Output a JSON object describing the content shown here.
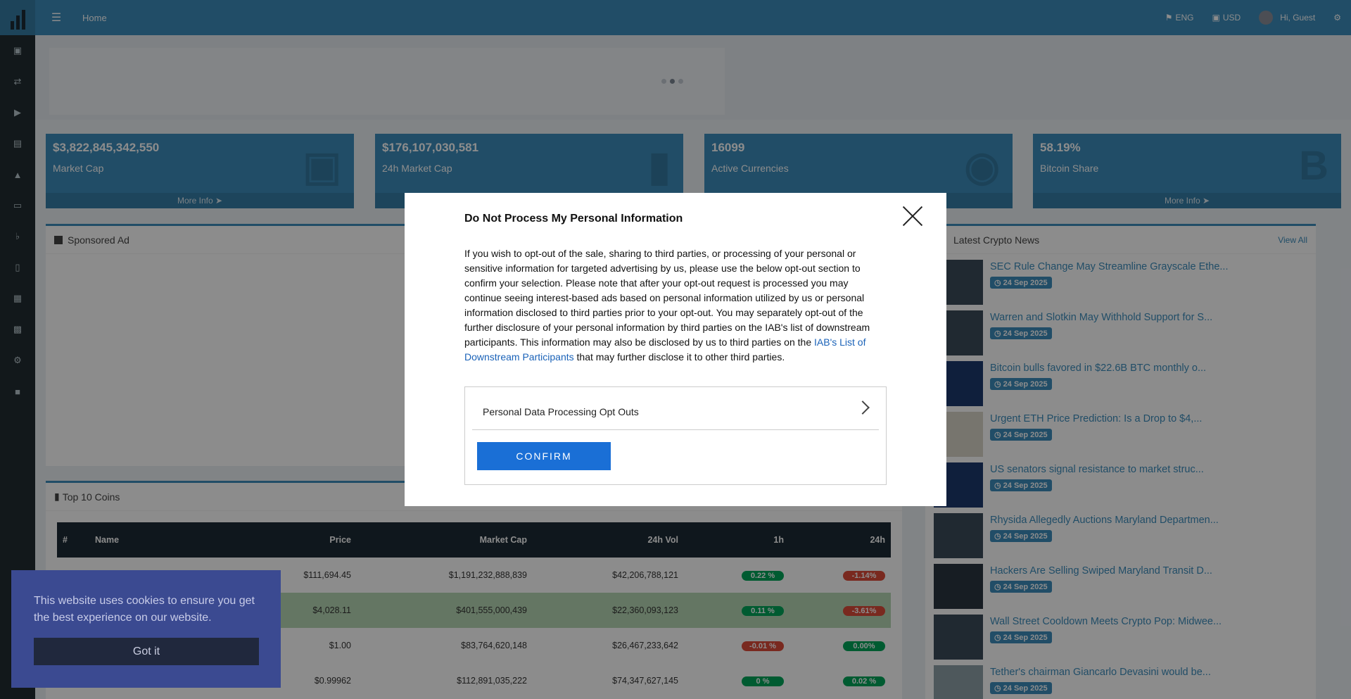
{
  "topbar": {
    "home": "Home",
    "language": "ENG",
    "currency": "USD",
    "greeting": "Hi, Guest"
  },
  "sidebar": {
    "icons": [
      "money-icon",
      "exchange-icon",
      "bullhorn-icon",
      "newspaper-icon",
      "bank-icon",
      "desktop-icon",
      "bell-icon",
      "mobile-icon",
      "table-icon",
      "book-icon",
      "gear-icon",
      "cube-icon"
    ]
  },
  "stats": [
    {
      "value": "$3,822,845,342,550",
      "label": "Market Cap",
      "more": "More Info"
    },
    {
      "value": "$176,107,030,581",
      "label": "24h Market Cap",
      "more": ""
    },
    {
      "value": "16099",
      "label": "Active Currencies",
      "more": ""
    },
    {
      "value": "58.19%",
      "label": "Bitcoin Share",
      "more": "More Info"
    }
  ],
  "sponsored": {
    "title": "Sponsored Ad"
  },
  "news": {
    "title": "Latest Crypto News",
    "view_all": "View All",
    "items": [
      {
        "title": "SEC Rule Change May Streamline Grayscale Ethe...",
        "date": "24 Sep 2025"
      },
      {
        "title": "Warren and Slotkin May Withhold Support for S...",
        "date": "24 Sep 2025"
      },
      {
        "title": "Bitcoin bulls favored in $22.6B BTC monthly o...",
        "date": "24 Sep 2025"
      },
      {
        "title": "Urgent ETH Price Prediction: Is a Drop to $4,...",
        "date": "24 Sep 2025"
      },
      {
        "title": "US senators signal resistance to market struc...",
        "date": "24 Sep 2025"
      },
      {
        "title": "Rhysida Allegedly Auctions Maryland Departmen...",
        "date": "24 Sep 2025"
      },
      {
        "title": "Hackers Are Selling Swiped Maryland Transit D...",
        "date": "24 Sep 2025"
      },
      {
        "title": "Wall Street Cooldown Meets Crypto Pop: Midwee...",
        "date": "24 Sep 2025"
      },
      {
        "title": "Tether's chairman Giancarlo Devasini would be...",
        "date": "24 Sep 2025"
      }
    ]
  },
  "top_coins": {
    "title": "Top 10 Coins",
    "headers": [
      "#",
      "Name",
      "Price",
      "Market Cap",
      "24h Vol",
      "1h",
      "24h"
    ],
    "rows": [
      {
        "price": "$111,694.45",
        "cap": "$1,191,232,888,839",
        "vol": "$42,206,788,121",
        "h1": "0.22 %",
        "h24": "-1.14%"
      },
      {
        "price": "$4,028.11",
        "cap": "$401,555,000,439",
        "vol": "$22,360,093,123",
        "h1": "0.11 %",
        "h24": "-3.61%"
      },
      {
        "price": "$1.00",
        "cap": "$83,764,620,148",
        "vol": "$26,467,233,642",
        "h1": "-0.01 %",
        "h24": "0.00%"
      },
      {
        "price": "$0.99962",
        "cap": "$112,891,035,222",
        "vol": "$74,347,627,145",
        "h1": "0 %",
        "h24": "0.02 %"
      }
    ]
  },
  "modal": {
    "title": "Do Not Process My Personal Information",
    "body": "If you wish to opt-out of the sale, sharing to third parties, or processing of your personal or sensitive information for targeted advertising by us, please use the below opt-out section to confirm your selection. Please note that after your opt-out request is processed you may continue seeing interest-based ads based on personal information utilized by us or personal information disclosed to third parties prior to your opt-out. You may separately opt-out of the further disclosure of your personal information by third parties on the IAB's list of downstream participants. This information may also be disclosed by us to third parties on the ",
    "link": "IAB's List of Downstream Participants",
    "tail": " that may further disclose it to other third parties.",
    "opt_label": "Personal Data Processing Opt Outs",
    "confirm": "CONFIRM"
  },
  "cookie": {
    "text": "This website uses cookies to ensure you get the best experience on our website.",
    "button": "Got it"
  }
}
